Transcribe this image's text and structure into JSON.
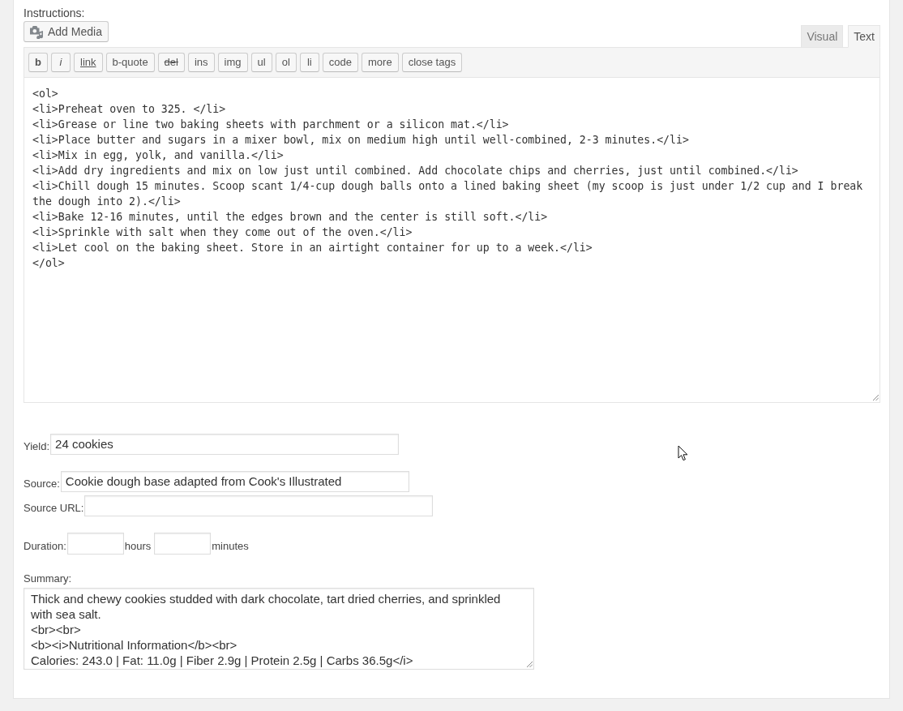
{
  "editor": {
    "label": "Instructions:",
    "add_media": "Add Media",
    "tabs": [
      {
        "label": "Visual",
        "selected": false
      },
      {
        "label": "Text",
        "selected": true
      }
    ],
    "toolbar": [
      {
        "label": "b",
        "kind": "bold"
      },
      {
        "label": "i",
        "kind": "italic"
      },
      {
        "label": "link",
        "kind": "underline"
      },
      {
        "label": "b-quote",
        "kind": "plain"
      },
      {
        "label": "del",
        "kind": "strike"
      },
      {
        "label": "ins",
        "kind": "plain"
      },
      {
        "label": "img",
        "kind": "plain"
      },
      {
        "label": "ul",
        "kind": "plain"
      },
      {
        "label": "ol",
        "kind": "plain"
      },
      {
        "label": "li",
        "kind": "plain"
      },
      {
        "label": "code",
        "kind": "plain"
      },
      {
        "label": "more",
        "kind": "plain"
      },
      {
        "label": "close tags",
        "kind": "plain"
      }
    ],
    "value": "<ol>\n<li>Preheat oven to 325. </li>\n<li>Grease or line two baking sheets with parchment or a silicon mat.</li>\n<li>Place butter and sugars in a mixer bowl, mix on medium high until well-combined, 2-3 minutes.</li>\n<li>Mix in egg, yolk, and vanilla.</li>\n<li>Add dry ingredients and mix on low just until combined. Add chocolate chips and cherries, just until combined.</li>\n<li>Chill dough 15 minutes. Scoop scant 1/4-cup dough balls onto a lined baking sheet (my scoop is just under 1/2 cup and I break the dough into 2).</li>\n<li>Bake 12-16 minutes, until the edges brown and the center is still soft.</li>\n<li>Sprinkle with salt when they come out of the oven.</li>\n<li>Let cool on the baking sheet. Store in an airtight container for up to a week.</li>\n</ol>"
  },
  "yield": {
    "label": "Yield:",
    "value": "24 cookies"
  },
  "source": {
    "label": "Source:",
    "value": "Cookie dough base adapted from Cook's Illustrated"
  },
  "source_url": {
    "label": "Source URL:"
  },
  "duration": {
    "label": "Duration:",
    "units": [
      "hours",
      "minutes"
    ]
  },
  "summary": {
    "label": "Summary:",
    "value": "Thick and chewy cookies studded with dark chocolate, tart dried cherries, and sprinkled with sea salt.\n<br><br>\n<b><i>Nutritional Information</b><br>\nCalories: 243.0 | Fat: 11.0g | Fiber 2.9g | Protein 2.5g | Carbs 36.5g</i>"
  }
}
